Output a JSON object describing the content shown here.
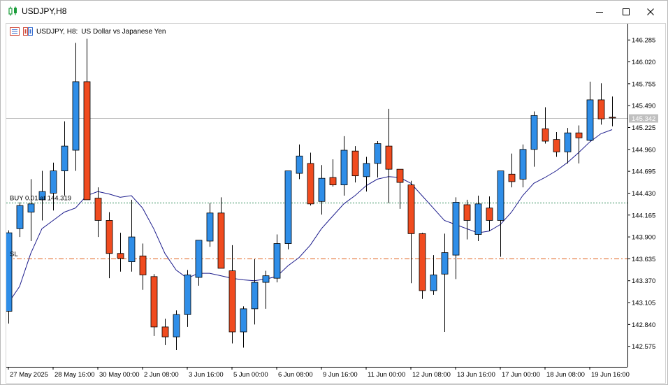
{
  "window": {
    "title": "USDJPY,H8"
  },
  "chart": {
    "symbol_label": "USDJPY, H8:",
    "description": "US Dollar vs Japanese Yen",
    "current_price_label": "145.342",
    "buy_label": "BUY 0.01 at 144.319",
    "sl_label": "SL",
    "colors": {
      "bull": "#2f8ee8",
      "bear": "#f04b1f",
      "ma": "#1c1c8c",
      "buy_line": "#2e8b57",
      "sl_line": "#e0601a",
      "bid_line": "#c0c0c0"
    }
  },
  "chart_data": {
    "type": "candlestick",
    "price_levels": [
      "146.285",
      "146.020",
      "145.755",
      "145.490",
      "145.225",
      "144.960",
      "144.695",
      "144.430",
      "144.165",
      "143.900",
      "143.635",
      "143.370",
      "143.105",
      "142.840",
      "142.575"
    ],
    "time_labels": [
      "27 May 2025",
      "28 May 16:00",
      "30 May 00:00",
      "2 Jun 08:00",
      "3 Jun 16:00",
      "5 Jun 00:00",
      "6 Jun 08:00",
      "9 Jun 16:00",
      "11 Jun 00:00",
      "12 Jun 08:00",
      "13 Jun 16:00",
      "17 Jun 00:00",
      "18 Jun 08:00",
      "19 Jun 16:00"
    ],
    "ylim": [
      142.42,
      146.38
    ],
    "buy_price": 144.319,
    "sl_price": 143.635,
    "bid_price": 145.342,
    "candles": [
      {
        "o": 143.0,
        "h": 143.98,
        "l": 142.85,
        "c": 143.95
      },
      {
        "o": 144.0,
        "h": 144.32,
        "l": 143.9,
        "c": 144.28
      },
      {
        "o": 144.2,
        "h": 144.6,
        "l": 143.85,
        "c": 144.3
      },
      {
        "o": 144.35,
        "h": 144.7,
        "l": 144.1,
        "c": 144.45
      },
      {
        "o": 144.43,
        "h": 144.8,
        "l": 144.22,
        "c": 144.7
      },
      {
        "o": 144.7,
        "h": 145.3,
        "l": 144.4,
        "c": 145.0
      },
      {
        "o": 144.95,
        "h": 146.25,
        "l": 144.7,
        "c": 145.78
      },
      {
        "o": 145.78,
        "h": 146.3,
        "l": 144.5,
        "c": 144.35
      },
      {
        "o": 144.37,
        "h": 144.5,
        "l": 143.9,
        "c": 144.1
      },
      {
        "o": 144.1,
        "h": 144.2,
        "l": 143.4,
        "c": 143.7
      },
      {
        "o": 143.7,
        "h": 143.95,
        "l": 143.48,
        "c": 143.64
      },
      {
        "o": 143.6,
        "h": 144.35,
        "l": 143.48,
        "c": 143.9
      },
      {
        "o": 143.67,
        "h": 143.82,
        "l": 143.26,
        "c": 143.44
      },
      {
        "o": 143.42,
        "h": 143.45,
        "l": 142.7,
        "c": 142.81
      },
      {
        "o": 142.81,
        "h": 142.91,
        "l": 142.59,
        "c": 142.69
      },
      {
        "o": 142.69,
        "h": 143.01,
        "l": 142.53,
        "c": 142.96
      },
      {
        "o": 142.96,
        "h": 143.5,
        "l": 142.81,
        "c": 143.44
      },
      {
        "o": 143.41,
        "h": 143.68,
        "l": 143.31,
        "c": 143.86
      },
      {
        "o": 143.85,
        "h": 144.31,
        "l": 143.78,
        "c": 144.19
      },
      {
        "o": 144.19,
        "h": 144.38,
        "l": 143.52,
        "c": 143.52
      },
      {
        "o": 143.49,
        "h": 143.8,
        "l": 142.61,
        "c": 142.75
      },
      {
        "o": 142.75,
        "h": 143.06,
        "l": 142.56,
        "c": 143.03
      },
      {
        "o": 143.03,
        "h": 143.63,
        "l": 142.84,
        "c": 143.35
      },
      {
        "o": 143.35,
        "h": 143.49,
        "l": 143.03,
        "c": 143.43
      },
      {
        "o": 143.4,
        "h": 143.93,
        "l": 143.35,
        "c": 143.82
      },
      {
        "o": 143.82,
        "h": 144.69,
        "l": 143.75,
        "c": 144.7
      },
      {
        "o": 144.67,
        "h": 145.02,
        "l": 144.6,
        "c": 144.88
      },
      {
        "o": 144.79,
        "h": 144.92,
        "l": 144.28,
        "c": 144.3
      },
      {
        "o": 144.33,
        "h": 144.77,
        "l": 144.17,
        "c": 144.61
      },
      {
        "o": 144.62,
        "h": 144.84,
        "l": 144.51,
        "c": 144.53
      },
      {
        "o": 144.53,
        "h": 145.12,
        "l": 144.4,
        "c": 144.95
      },
      {
        "o": 144.94,
        "h": 145.0,
        "l": 144.56,
        "c": 144.64
      },
      {
        "o": 144.63,
        "h": 144.87,
        "l": 144.45,
        "c": 144.79
      },
      {
        "o": 144.79,
        "h": 145.06,
        "l": 144.62,
        "c": 145.03
      },
      {
        "o": 145.0,
        "h": 145.45,
        "l": 144.31,
        "c": 144.72
      },
      {
        "o": 144.72,
        "h": 144.72,
        "l": 144.24,
        "c": 144.56
      },
      {
        "o": 144.53,
        "h": 144.58,
        "l": 143.34,
        "c": 143.94
      },
      {
        "o": 143.94,
        "h": 143.95,
        "l": 143.15,
        "c": 143.25
      },
      {
        "o": 143.25,
        "h": 143.68,
        "l": 143.2,
        "c": 143.44
      },
      {
        "o": 143.45,
        "h": 143.94,
        "l": 142.75,
        "c": 143.71
      },
      {
        "o": 143.68,
        "h": 144.38,
        "l": 143.39,
        "c": 144.32
      },
      {
        "o": 144.29,
        "h": 144.35,
        "l": 143.87,
        "c": 144.1
      },
      {
        "o": 143.93,
        "h": 144.4,
        "l": 143.85,
        "c": 144.3
      },
      {
        "o": 144.25,
        "h": 144.39,
        "l": 143.97,
        "c": 144.1
      },
      {
        "o": 144.1,
        "h": 144.7,
        "l": 143.66,
        "c": 144.7
      },
      {
        "o": 144.66,
        "h": 144.91,
        "l": 144.5,
        "c": 144.57
      },
      {
        "o": 144.6,
        "h": 145.02,
        "l": 144.5,
        "c": 144.96
      },
      {
        "o": 144.96,
        "h": 145.42,
        "l": 144.75,
        "c": 145.37
      },
      {
        "o": 145.21,
        "h": 145.47,
        "l": 145.03,
        "c": 145.06
      },
      {
        "o": 145.08,
        "h": 145.17,
        "l": 144.87,
        "c": 144.93
      },
      {
        "o": 144.93,
        "h": 145.22,
        "l": 144.79,
        "c": 145.16
      },
      {
        "o": 145.16,
        "h": 145.25,
        "l": 144.79,
        "c": 145.1
      },
      {
        "o": 145.07,
        "h": 145.78,
        "l": 145.06,
        "c": 145.56
      },
      {
        "o": 145.56,
        "h": 145.76,
        "l": 145.26,
        "c": 145.33
      },
      {
        "o": 145.35,
        "h": 145.6,
        "l": 145.24,
        "c": 145.34
      }
    ],
    "ma": [
      143.1,
      143.3,
      143.7,
      144.0,
      144.1,
      144.2,
      144.25,
      144.4,
      144.45,
      144.42,
      144.38,
      144.4,
      144.25,
      144.0,
      143.7,
      143.5,
      143.4,
      143.46,
      143.46,
      143.43,
      143.4,
      143.38,
      143.37,
      143.39,
      143.42,
      143.55,
      143.65,
      143.8,
      144.0,
      144.15,
      144.3,
      144.4,
      144.52,
      144.6,
      144.63,
      144.62,
      144.55,
      144.4,
      144.25,
      144.1,
      144.05,
      144.0,
      143.95,
      143.97,
      144.05,
      144.2,
      144.4,
      144.55,
      144.62,
      144.7,
      144.8,
      144.92,
      145.05,
      145.15,
      145.2
    ]
  }
}
